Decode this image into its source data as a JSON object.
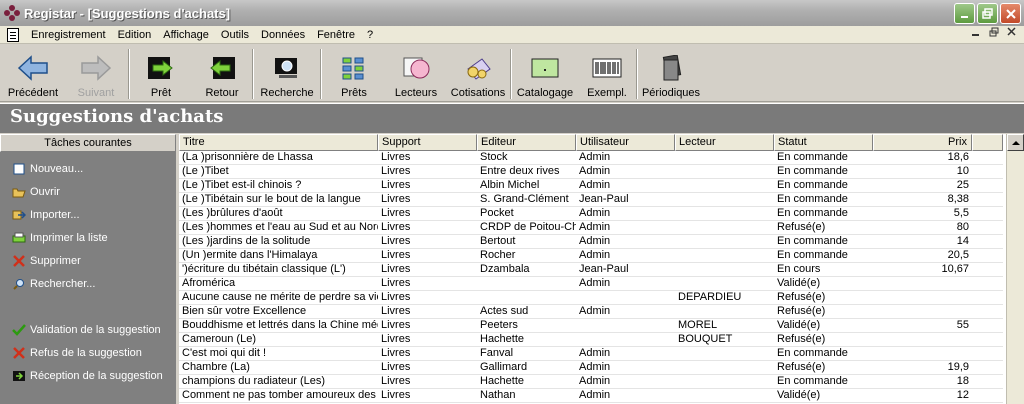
{
  "window": {
    "title": "Registar - [Suggestions d'achats]"
  },
  "menu": [
    "Enregistrement",
    "Edition",
    "Affichage",
    "Outils",
    "Données",
    "Fenêtre",
    "?"
  ],
  "toolbar": {
    "precedent": "Précédent",
    "suivant": "Suivant",
    "pret": "Prêt",
    "retour": "Retour",
    "recherche": "Recherche",
    "prets": "Prêts",
    "lecteurs": "Lecteurs",
    "cotisations": "Cotisations",
    "catalogage": "Catalogage",
    "exempl": "Exempl.",
    "periodiques": "Périodiques"
  },
  "page": {
    "title": "Suggestions d'achats"
  },
  "tasks": {
    "header": "Tâches courantes",
    "nouveau": "Nouveau...",
    "ouvrir": "Ouvrir",
    "importer": "Importer...",
    "imprimer": "Imprimer la liste",
    "supprimer": "Supprimer",
    "rechercher": "Rechercher...",
    "validation": "Validation de la suggestion",
    "refus": "Refus de la suggestion",
    "reception": "Réception de la suggestion"
  },
  "table": {
    "columns": [
      "Titre",
      "Support",
      "Editeur",
      "Utilisateur",
      "Lecteur",
      "Statut",
      "Prix"
    ],
    "rows": [
      [
        "(La )prisonnière de Lhassa",
        "Livres",
        "Stock",
        "Admin",
        "",
        "En commande",
        "18,6"
      ],
      [
        "(Le )Tibet",
        "Livres",
        "Entre deux rives",
        "Admin",
        "",
        "En commande",
        "10"
      ],
      [
        "(Le )Tibet est-il chinois ?",
        "Livres",
        "Albin Michel",
        "Admin",
        "",
        "En commande",
        "25"
      ],
      [
        "(Le )Tibétain sur le bout de la langue",
        "Livres",
        "S. Grand-Clément",
        "Jean-Paul",
        "",
        "En commande",
        "8,38"
      ],
      [
        "(Les )brûlures d'août",
        "Livres",
        "Pocket",
        "Admin",
        "",
        "En commande",
        "5,5"
      ],
      [
        "(Les )hommes et l'eau au Sud et au Nord",
        "Livres",
        "CRDP de Poitou-Ch",
        "Admin",
        "",
        "Refusé(e)",
        "80"
      ],
      [
        "(Les )jardins de la solitude",
        "Livres",
        "Bertout",
        "Admin",
        "",
        "En commande",
        "14"
      ],
      [
        "(Un )ermite dans l'Himalaya",
        "Livres",
        "Rocher",
        "Admin",
        "",
        "En commande",
        "20,5"
      ],
      [
        "')écriture du tibétain classique (L')",
        "Livres",
        "Dzambala",
        "Jean-Paul",
        "",
        "En cours",
        "10,67"
      ],
      [
        "Afromérica",
        "Livres",
        "",
        "Admin",
        "",
        "Validé(e)",
        ""
      ],
      [
        "Aucune cause ne mérite de perdre sa vie",
        "Livres",
        "",
        "",
        "DEPARDIEU",
        "Refusé(e)",
        ""
      ],
      [
        "Bien sûr votre Excellence",
        "Livres",
        "Actes sud",
        "Admin",
        "",
        "Refusé(e)",
        ""
      ],
      [
        "Bouddhisme et lettrés dans la Chine médiévale",
        "Livres",
        "Peeters",
        "",
        "MOREL",
        "Validé(e)",
        "55"
      ],
      [
        "Cameroun (Le)",
        "Livres",
        "Hachette",
        "",
        "BOUQUET",
        "Refusé(e)",
        ""
      ],
      [
        "C'est moi qui dit !",
        "Livres",
        "Fanval",
        "Admin",
        "",
        "En commande",
        ""
      ],
      [
        "Chambre (La)",
        "Livres",
        "Gallimard",
        "Admin",
        "",
        "Refusé(e)",
        "19,9"
      ],
      [
        "champions du radiateur (Les)",
        "Livres",
        "Hachette",
        "Admin",
        "",
        "En commande",
        "18"
      ],
      [
        "Comment ne pas tomber amoureux des femmes",
        "Livres",
        "Nathan",
        "Admin",
        "",
        "Validé(e)",
        "12"
      ]
    ]
  }
}
